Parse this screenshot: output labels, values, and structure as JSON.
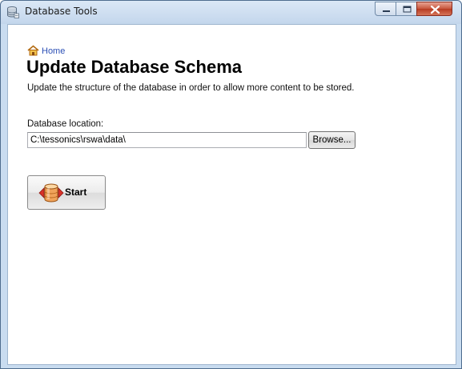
{
  "window": {
    "title": "Database Tools",
    "controls": {
      "minimize": "minimize",
      "maximize": "maximize",
      "close": "close"
    }
  },
  "breadcrumb": {
    "home_label": "Home"
  },
  "page": {
    "title": "Update Database Schema",
    "subtitle": "Update the structure of the database in order to allow more content to be stored."
  },
  "location": {
    "label": "Database location:",
    "value": "C:\\tessonics\\rswa\\data\\",
    "browse_label": "Browse..."
  },
  "start_button": {
    "label": "Start"
  },
  "colors": {
    "link": "#2b4fb5",
    "close_button": "#c7553c",
    "title_bar": "#c9dcf0"
  }
}
